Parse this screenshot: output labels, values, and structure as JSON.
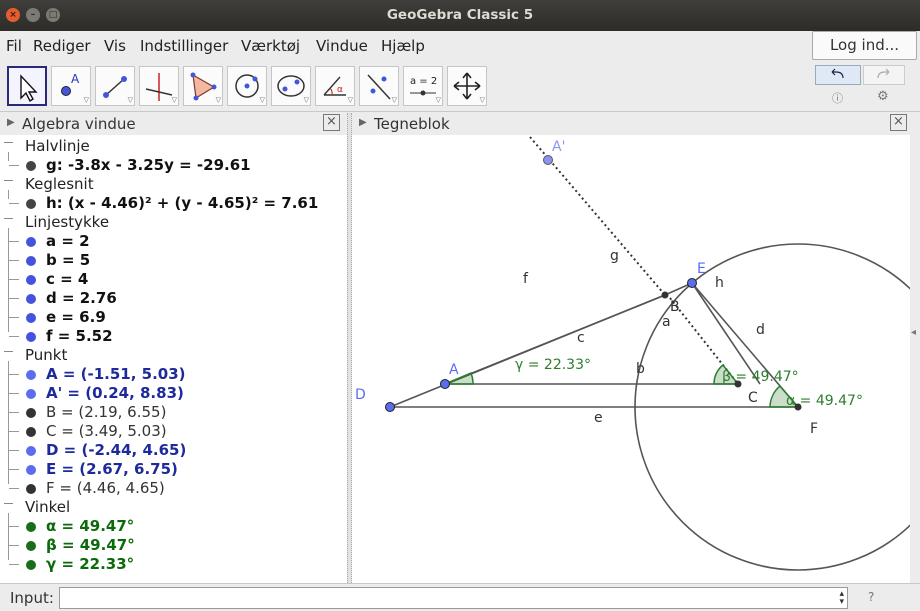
{
  "window": {
    "title": "GeoGebra Classic 5"
  },
  "menu": [
    "Fil",
    "Rediger",
    "Vis",
    "Indstillinger",
    "Værktøj",
    "Vindue",
    "Hjælp"
  ],
  "login_label": "Log ind...",
  "toolbar": {
    "tools": [
      "move-tool",
      "point-tool",
      "line-tool",
      "perpendicular-tool",
      "polygon-tool",
      "circle-tool",
      "conic-tool",
      "angle-tool",
      "reflect-tool",
      "slider-tool",
      "move-view-tool"
    ],
    "slider_tool_text": "a = 2",
    "point_tool_text": "A"
  },
  "algebra": {
    "title": "Algebra vindue",
    "close": "×",
    "categories": [
      {
        "name": "Halvlinje",
        "items": [
          {
            "text": "g: -3.8x - 3.25y = -29.61",
            "style": "black"
          }
        ]
      },
      {
        "name": "Keglesnit",
        "items": [
          {
            "text": "h: (x - 4.46)² + (y - 4.65)² = 7.61",
            "style": "black"
          }
        ]
      },
      {
        "name": "Linjestykke",
        "items": [
          {
            "text": "a = 2",
            "style": "black"
          },
          {
            "text": "b = 5",
            "style": "black"
          },
          {
            "text": "c = 4",
            "style": "black"
          },
          {
            "text": "d = 2.76",
            "style": "black"
          },
          {
            "text": "e = 6.9",
            "style": "black"
          },
          {
            "text": "f = 5.52",
            "style": "black"
          }
        ]
      },
      {
        "name": "Punkt",
        "items": [
          {
            "text": "A = (-1.51, 5.03)",
            "style": "blue"
          },
          {
            "text": "A' = (0.24, 8.83)",
            "style": "blue"
          },
          {
            "text": "B = (2.19, 6.55)",
            "style": "dark"
          },
          {
            "text": "C = (3.49, 5.03)",
            "style": "dark"
          },
          {
            "text": "D = (-2.44, 4.65)",
            "style": "blue"
          },
          {
            "text": "E = (2.67, 6.75)",
            "style": "blue"
          },
          {
            "text": "F = (4.46, 4.65)",
            "style": "dark"
          }
        ]
      },
      {
        "name": "Vinkel",
        "items": [
          {
            "text": "α = 49.47°",
            "style": "green"
          },
          {
            "text": "β = 49.47°",
            "style": "green"
          },
          {
            "text": "γ = 22.33°",
            "style": "green"
          }
        ]
      }
    ]
  },
  "graphics": {
    "title": "Tegneblok",
    "close": "×",
    "point_labels": {
      "A": "A",
      "A_prime": "A'",
      "B": "B",
      "C": "C",
      "D": "D",
      "E": "E",
      "F": "F"
    },
    "segment_labels": {
      "a": "a",
      "b": "b",
      "c": "c",
      "d": "d",
      "e": "e",
      "f": "f",
      "g": "g",
      "h": "h"
    },
    "angle_labels": {
      "alpha": "α = 49.47°",
      "beta": "β = 49.47°",
      "gamma": "γ = 22.33°"
    },
    "colors": {
      "free_point": "#5b6cf0",
      "dependent_point": "#333333",
      "angle": "#2e7d2e",
      "segment": "#555555"
    }
  },
  "input": {
    "label": "Input:",
    "value": "",
    "help": "?"
  }
}
